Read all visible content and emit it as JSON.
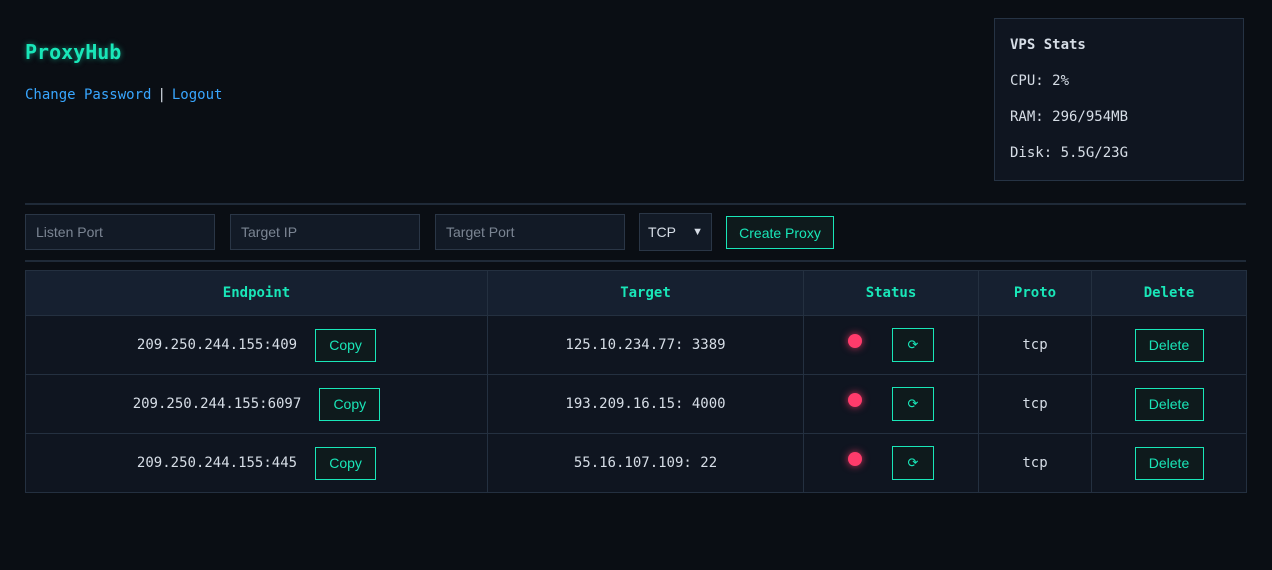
{
  "app": {
    "title": "ProxyHub"
  },
  "nav": {
    "change_password": "Change Password",
    "separator": "|",
    "logout": "Logout"
  },
  "stats": {
    "title": "VPS Stats",
    "cpu": "CPU: 2%",
    "ram": "RAM: 296/954MB",
    "disk": "Disk: 5.5G/23G"
  },
  "form": {
    "listen_port_placeholder": "Listen Port",
    "target_ip_placeholder": "Target IP",
    "target_port_placeholder": "Target Port",
    "protocol_selected": "TCP",
    "create_label": "Create Proxy"
  },
  "table": {
    "headers": [
      "Endpoint",
      "Target",
      "Status",
      "Proto",
      "Delete"
    ],
    "copy_label": "Copy",
    "refresh_icon": "⟳",
    "delete_label": "Delete",
    "rows": [
      {
        "endpoint": "209.250.244.155:409",
        "target": "125.10.234.77: 3389",
        "proto": "tcp"
      },
      {
        "endpoint": "209.250.244.155:6097",
        "target": "193.209.16.15: 4000",
        "proto": "tcp"
      },
      {
        "endpoint": "209.250.244.155:445",
        "target": "55.16.107.109: 22",
        "proto": "tcp"
      }
    ]
  },
  "colors": {
    "accent": "#19e6b8",
    "link": "#38a6ff",
    "status_down": "#ff3b6b",
    "background": "#0a0e14"
  },
  "icons": {
    "refresh": "refresh-icon",
    "status": "status-dot-icon",
    "dropdown": "chevron-down-icon"
  }
}
